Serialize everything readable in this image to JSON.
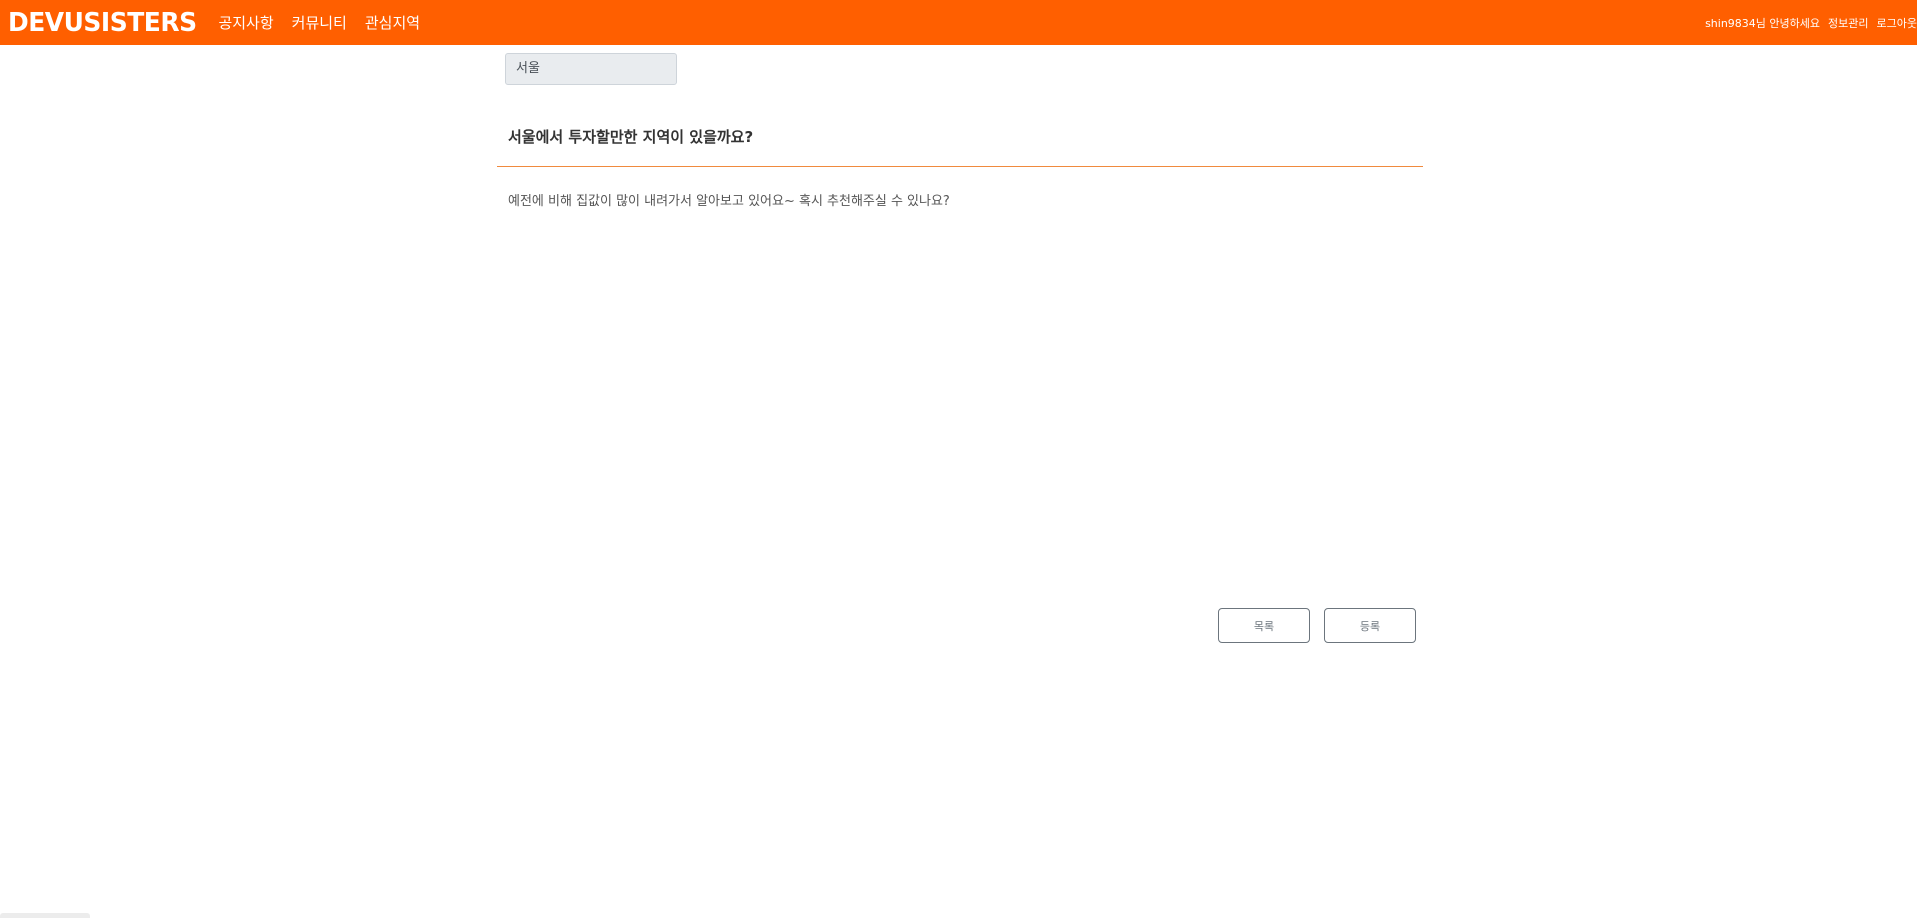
{
  "header": {
    "logo": "DEVUSISTERS",
    "nav": [
      {
        "label": "공지사항"
      },
      {
        "label": "커뮤니티"
      },
      {
        "label": "관심지역"
      }
    ],
    "user": {
      "greeting": "shin9834님 안녕하세요",
      "profile_link": "정보관리",
      "logout_link": "로그아웃"
    }
  },
  "post": {
    "region": "서울",
    "title": "서울에서 투자할만한 지역이 있을까요?",
    "body": "예전에 비해 집값이 많이 내려가서 알아보고 있어요~ 혹시 추천해주실 수 있나요?"
  },
  "actions": {
    "list_label": "목록",
    "submit_label": "등록"
  },
  "colors": {
    "header_bg": "#ff5f00",
    "divider": "#f08a3e"
  }
}
